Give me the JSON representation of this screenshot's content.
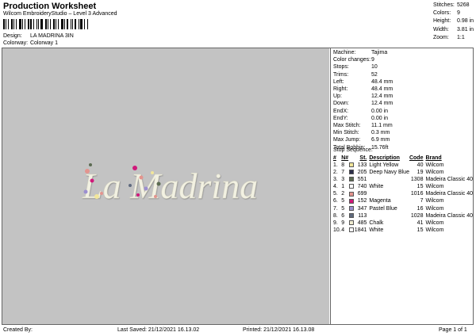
{
  "header": {
    "title": "Production Worksheet",
    "subtitle": "Wilcom EmbroideryStudio – Level 3 Advanced",
    "design_label": "Design:",
    "design_value": "LA MADRINA 3IN",
    "colorway_label": "Colorway:",
    "colorway_value": "Colorway 1"
  },
  "stats": [
    {
      "label": "Stitches:",
      "value": "5268"
    },
    {
      "label": "Colors:",
      "value": "9"
    },
    {
      "label": "Height:",
      "value": "0.98 in"
    },
    {
      "label": "Width:",
      "value": "3.81 in"
    },
    {
      "label": "Zoom:",
      "value": "1:1"
    }
  ],
  "design_text": "La Madrina",
  "machine_info": [
    {
      "label": "Machine:",
      "value": "Tajima"
    },
    {
      "label": "Color changes:",
      "value": "9"
    },
    {
      "label": "Stops:",
      "value": "10"
    },
    {
      "label": "Trims:",
      "value": "52"
    },
    {
      "label": "Left:",
      "value": "48.4 mm"
    },
    {
      "label": "Right:",
      "value": "48.4 mm"
    },
    {
      "label": "Up:",
      "value": "12.4 mm"
    },
    {
      "label": "Down:",
      "value": "12.4 mm"
    },
    {
      "label": "EndX:",
      "value": "0.00 in"
    },
    {
      "label": "EndY:",
      "value": "0.00 in"
    },
    {
      "label": "Max Stitch:",
      "value": "11.1 mm"
    },
    {
      "label": "Min Stitch:",
      "value": "0.3 mm"
    },
    {
      "label": "Max Jump:",
      "value": "6.9 mm"
    },
    {
      "label": "Total Bobbin:",
      "value": "15.76ft"
    }
  ],
  "stop_sequence": {
    "title": "Stop Sequence:",
    "headers": [
      "#",
      "N#",
      "",
      "St.",
      "Description",
      "Code",
      "Brand"
    ],
    "rows": [
      {
        "num": "1.",
        "n": "8",
        "color": "#f2e69a",
        "st": "133",
        "desc": "Light Yellow",
        "code": "40",
        "brand": "Wilcom"
      },
      {
        "num": "2.",
        "n": "7",
        "color": "#2c2f4a",
        "st": "205",
        "desc": "Deep Navy Blue",
        "code": "19",
        "brand": "Wilcom"
      },
      {
        "num": "3.",
        "n": "3",
        "color": "#5c6b52",
        "st": "551",
        "desc": "",
        "code": "1308",
        "brand": "Madeira Classic 40"
      },
      {
        "num": "4.",
        "n": "1",
        "color": "#ffffff",
        "st": "740",
        "desc": "White",
        "code": "15",
        "brand": "Wilcom"
      },
      {
        "num": "5.",
        "n": "2",
        "color": "#e3948e",
        "st": "699",
        "desc": "",
        "code": "1016",
        "brand": "Madeira Classic 40"
      },
      {
        "num": "6.",
        "n": "5",
        "color": "#d0187a",
        "st": "152",
        "desc": "Magenta",
        "code": "7",
        "brand": "Wilcom"
      },
      {
        "num": "7.",
        "n": "5",
        "color": "#9c8fd0",
        "st": "347",
        "desc": "Pastel Blue",
        "code": "16",
        "brand": "Wilcom"
      },
      {
        "num": "8.",
        "n": "6",
        "color": "#5f6a7e",
        "st": "113",
        "desc": "",
        "code": "1028",
        "brand": "Madeira Classic 40"
      },
      {
        "num": "9.",
        "n": "9",
        "color": "#f0ecd0",
        "st": "485",
        "desc": "Chalk",
        "code": "41",
        "brand": "Wilcom"
      },
      {
        "num": "10.",
        "n": "4",
        "color": "#ffffff",
        "st": "1841",
        "desc": "White",
        "code": "15",
        "brand": "Wilcom"
      }
    ]
  },
  "footer": {
    "created_by": "Created By:",
    "last_saved": "Last Saved: 21/12/2021 16.13.02",
    "printed": "Printed: 21/12/2021 16.13.08",
    "page": "Page 1 of 1"
  },
  "colors": {
    "canvas": "#c3c3c3",
    "letter_fill": "#f2f1e2"
  }
}
